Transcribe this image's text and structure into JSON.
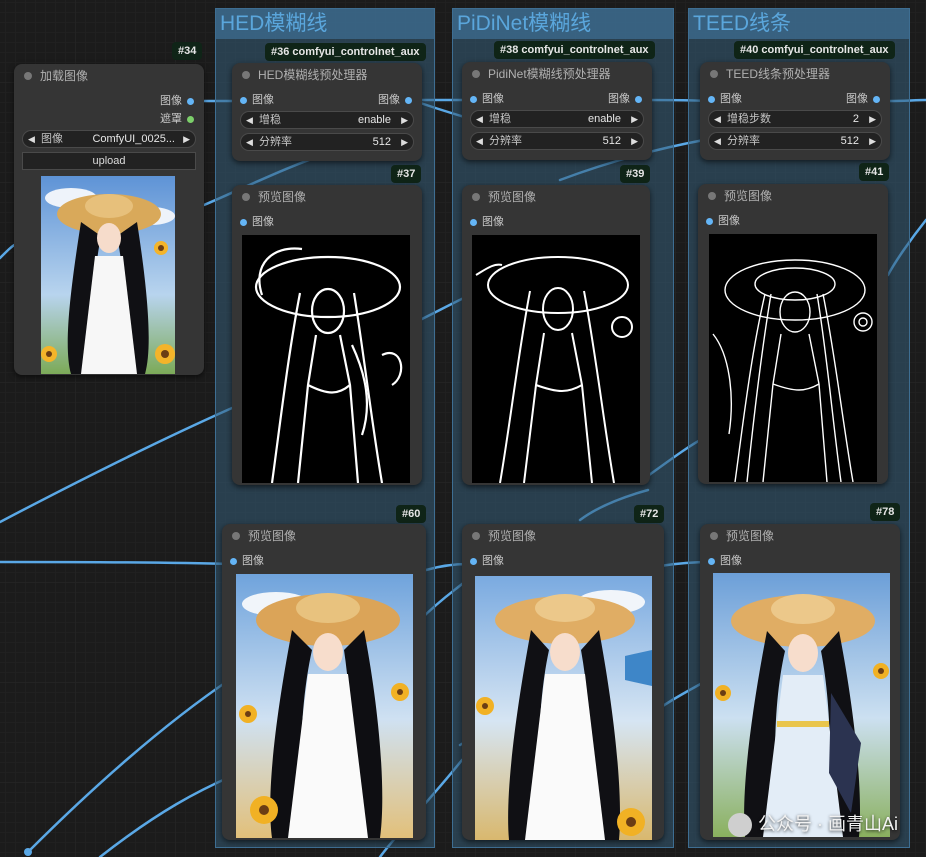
{
  "groups": [
    {
      "title": "HED模糊线"
    },
    {
      "title": "PiDiNet模糊线"
    },
    {
      "title": "TEED线条"
    }
  ],
  "load_node": {
    "id": "#34",
    "title": "加载图像",
    "out_image": "图像",
    "out_mask": "遮罩",
    "image_widget_label": "图像",
    "image_widget_value": "ComfyUI_0025...",
    "upload_label": "upload"
  },
  "preprocessors": [
    {
      "badge": "#36 comfyui_controlnet_aux",
      "title": "HED模糊线预处理器",
      "in": "图像",
      "out": "图像",
      "w1_label": "增稳",
      "w1_value": "enable",
      "w2_label": "分辨率",
      "w2_value": "512"
    },
    {
      "badge": "#38 comfyui_controlnet_aux",
      "title": "PidiNet模糊线预处理器",
      "in": "图像",
      "out": "图像",
      "w1_label": "增稳",
      "w1_value": "enable",
      "w2_label": "分辨率",
      "w2_value": "512"
    },
    {
      "badge": "#40 comfyui_controlnet_aux",
      "title": "TEED线条预处理器",
      "in": "图像",
      "out": "图像",
      "w1_label": "增稳步数",
      "w1_value": "2",
      "w2_label": "分辨率",
      "w2_value": "512"
    }
  ],
  "previews": [
    {
      "badge": "#37",
      "title": "预览图像",
      "in": "图像",
      "image": "hed-lineart-preview"
    },
    {
      "badge": "#39",
      "title": "预览图像",
      "in": "图像",
      "image": "pidinet-lineart-preview"
    },
    {
      "badge": "#41",
      "title": "预览图像",
      "in": "图像",
      "image": "teed-lineart-preview"
    },
    {
      "badge": "#60",
      "title": "预览图像",
      "in": "图像",
      "image": "hed-generated-preview"
    },
    {
      "badge": "#72",
      "title": "预览图像",
      "in": "图像",
      "image": "pidinet-generated-preview"
    },
    {
      "badge": "#78",
      "title": "预览图像",
      "in": "图像",
      "image": "teed-generated-preview"
    }
  ],
  "watermark": {
    "text": "公众号 · 画青山Ai",
    "icon": "wechat-icon"
  },
  "colors": {
    "wire": "#5aa8e6",
    "group_title": "#5aa6dc",
    "node": "#353535",
    "badge_bg": "#0f2417"
  }
}
